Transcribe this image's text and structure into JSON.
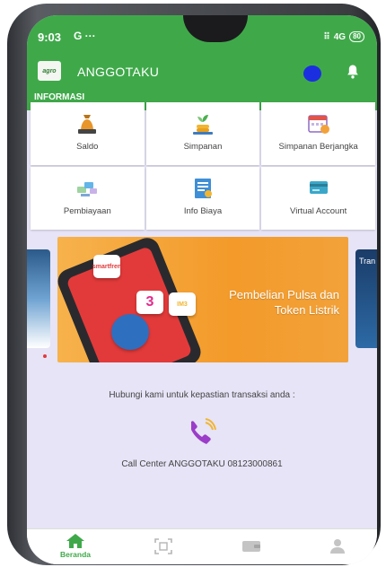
{
  "status": {
    "time": "9:03",
    "signal": "4G",
    "battery": "80"
  },
  "app": {
    "title": "ANGGOTAKU",
    "logo_text": "agro"
  },
  "section": {
    "label": "INFORMASI"
  },
  "menu": [
    {
      "label": "Saldo",
      "icon": "money-bag-icon"
    },
    {
      "label": "Simpanan",
      "icon": "plant-coins-icon"
    },
    {
      "label": "Simpanan Berjangka",
      "icon": "calendar-icon"
    },
    {
      "label": "Pembiayaan",
      "icon": "loan-icon"
    },
    {
      "label": "Info Biaya",
      "icon": "document-icon"
    },
    {
      "label": "Virtual Account",
      "icon": "card-icon"
    }
  ],
  "banner": {
    "title_line1": "Pembelian Pulsa dan",
    "title_line2": "Token Listrik",
    "tile1": "smartfren",
    "tile2": "3",
    "tile3": "IM3",
    "next_slide_text": "Tran"
  },
  "contact": {
    "prompt": "Hubungi kami untuk kepastian transaksi anda :",
    "call_center": "Call Center ANGGOTAKU 08123000861"
  },
  "nav": {
    "home_label": "Beranda"
  },
  "colors": {
    "primary": "#3fa94a",
    "background": "#e6e4f6",
    "accent": "#9b3dc8"
  }
}
